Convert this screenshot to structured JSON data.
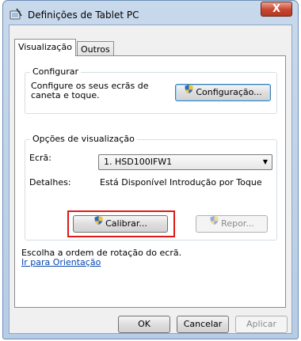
{
  "window": {
    "title": "Definições de Tablet PC",
    "close_glyph": "X",
    "title_icon": "tablet-pc-icon"
  },
  "tabs": [
    {
      "label": "Visualização",
      "active": true
    },
    {
      "label": "Outros",
      "active": false
    }
  ],
  "configure": {
    "group_label": "Configurar",
    "description": "Configure os seus ecrãs de caneta e toque.",
    "button_label": "Configuração..."
  },
  "display_options": {
    "group_label": "Opções de visualização",
    "screen_label": "Ecrã:",
    "screen_value": "1. HSD100IFW1",
    "details_label": "Detalhes:",
    "details_value": "Está Disponível Introdução por Toque",
    "calibrate_label": "Calibrar...",
    "reset_label": "Repor..."
  },
  "rotation": {
    "text": "Escolha a ordem de rotação do ecrã.",
    "link_text": "Ir para Orientação"
  },
  "footer": {
    "ok_label": "OK",
    "cancel_label": "Cancelar",
    "apply_label": "Aplicar"
  },
  "colors": {
    "highlight": "#e01919",
    "link": "#0645ad",
    "shield_blue": "#2a68c8",
    "shield_yellow": "#f4c430"
  }
}
